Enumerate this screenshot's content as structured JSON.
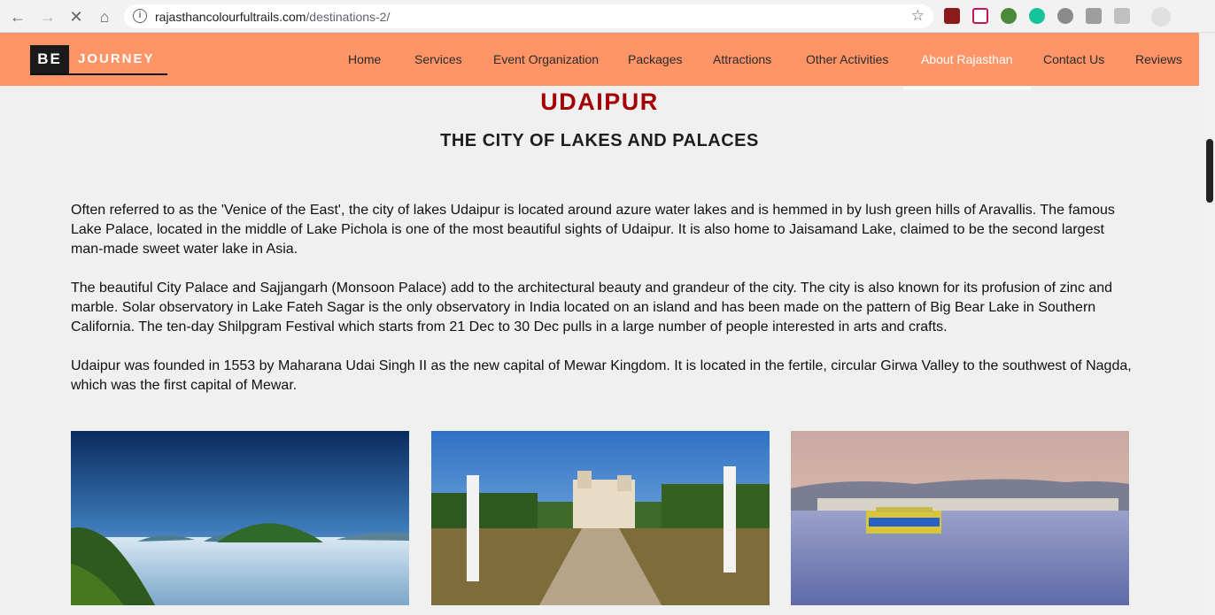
{
  "browser": {
    "url_host": "rajasthancolourfultrails.com",
    "url_path": "/destinations-2/"
  },
  "site": {
    "logo_be": "BE",
    "logo_journey": "JOURNEY",
    "nav": [
      "Home",
      "Services",
      "Event Organization",
      "Packages",
      "Attractions",
      "Other Activities",
      "About Rajasthan",
      "Contact Us",
      "Reviews"
    ],
    "active_nav": "About Rajasthan"
  },
  "page": {
    "title": "UDAIPUR",
    "subtitle": "THE CITY OF LAKES AND PALACES",
    "paragraphs": [
      "Often referred to as the 'Venice of the East', the city of lakes Udaipur is located around azure water lakes and is hemmed in by lush green hills of Aravallis. The famous Lake Palace, located in the middle of Lake Pichola is one of the most beautiful sights of Udaipur. It is also home to Jaisamand Lake, claimed to be the second largest man-made sweet water lake in Asia.",
      "The beautiful City Palace and Sajjangarh (Monsoon Palace) add to the architectural beauty and grandeur of the city. The city is also known for its profusion of zinc and marble. Solar observatory in Lake Fateh Sagar is the only observatory in India located on an island and has been made on the pattern of Big Bear Lake in Southern California. The ten-day Shilpgram Festival which starts from 21 Dec to 30 Dec pulls in a large number of people interested in arts and crafts.",
      "Udaipur was founded in 1553 by Maharana Udai Singh II as the new capital of Mewar Kingdom. It is located in the fertile, circular Girwa Valley to the southwest of Nagda, which was the first capital of Mewar."
    ]
  },
  "colors": {
    "header": "#ff9466",
    "title": "#a50000"
  }
}
